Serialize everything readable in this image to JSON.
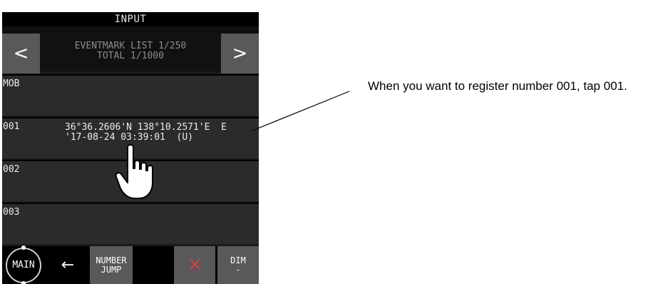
{
  "screen": {
    "title": "INPUT",
    "header": {
      "line1": "EVENTMARK LIST 1/250",
      "line2": "TOTAL 1/1000",
      "prev_icon": "<",
      "next_icon": ">"
    },
    "rows": [
      {
        "id": "MOB",
        "line1": "",
        "line2": ""
      },
      {
        "id": "001",
        "line1": "36°36.2606'N 138°10.2571'E  E",
        "line2": "'17-08-24 03:39:01  (U)"
      },
      {
        "id": "002",
        "line1": "",
        "line2": ""
      },
      {
        "id": "003",
        "line1": "",
        "line2": ""
      }
    ],
    "bottom": {
      "main_label": "MAIN",
      "back_icon": "←",
      "jump_line1": "NUMBER",
      "jump_line2": "JUMP",
      "delete_icon": "✕",
      "dim_line1": "DIM",
      "dim_line2": "-"
    }
  },
  "annotation": {
    "text": "When you want to register number 001, tap 001."
  },
  "colors": {
    "button_gray": "#595959",
    "row_bg": "#2b2b2b",
    "delete_red": "#e23b3b"
  },
  "icons": {
    "pointer": "hand-pointer-icon"
  }
}
